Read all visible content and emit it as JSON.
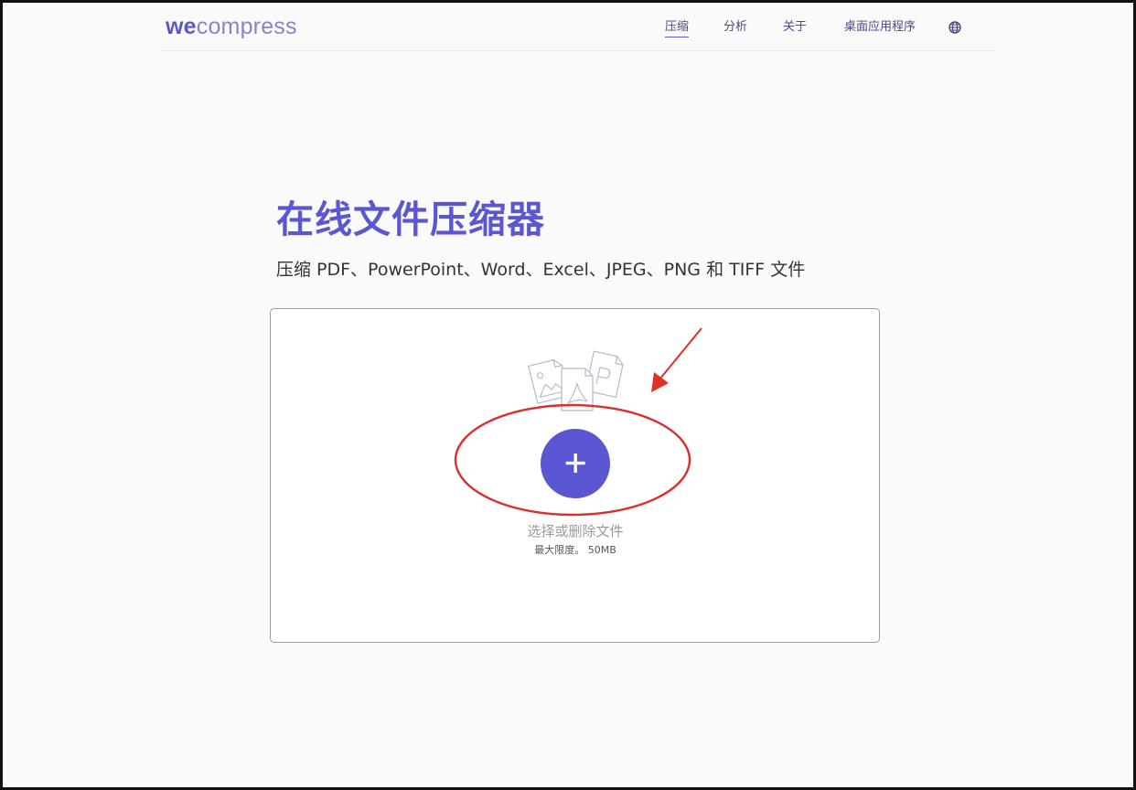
{
  "header": {
    "logo_prefix": "we",
    "logo_suffix": "compress",
    "nav": [
      {
        "label": "压缩",
        "active": true
      },
      {
        "label": "分析",
        "active": false
      },
      {
        "label": "关于",
        "active": false
      },
      {
        "label": "桌面应用程序",
        "active": false
      }
    ],
    "language_icon": "globe-icon"
  },
  "hero": {
    "title": "在线文件压缩器",
    "subtitle": "压缩 PDF、PowerPoint、Word、Excel、JPEG、PNG 和 TIFF 文件"
  },
  "upload": {
    "file_type_icons": [
      "image-file-icon",
      "pdf-file-icon",
      "document-file-icon"
    ],
    "add_icon": "plus-icon",
    "select_text": "选择或删除文件",
    "limit_text": "最大限度。 50MB"
  },
  "annotations": {
    "circle_color": "#d9302c",
    "arrow_color": "#e0302a"
  },
  "colors": {
    "accent": "#5b57d2",
    "logo": "#8884c9",
    "nav_text": "#4a4a85"
  }
}
